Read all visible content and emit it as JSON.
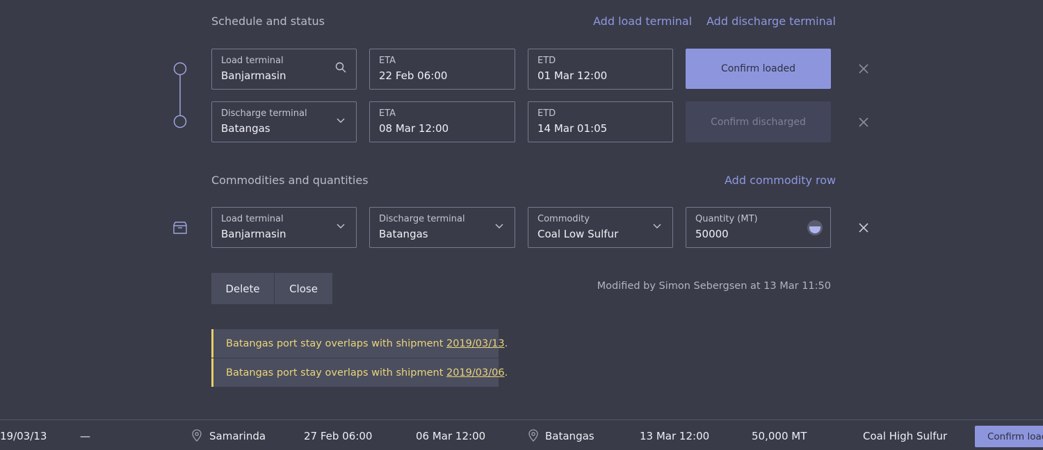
{
  "schedule": {
    "title": "Schedule and status",
    "add_load_link": "Add load terminal",
    "add_discharge_link": "Add discharge terminal",
    "load_row": {
      "terminal_label": "Load terminal",
      "terminal_value": "Banjarmasin",
      "eta_label": "ETA",
      "eta_value": "22 Feb 06:00",
      "etd_label": "ETD",
      "etd_value": "01 Mar 12:00",
      "confirm_label": "Confirm loaded"
    },
    "discharge_row": {
      "terminal_label": "Discharge terminal",
      "terminal_value": "Batangas",
      "eta_label": "ETA",
      "eta_value": "08 Mar 12:00",
      "etd_label": "ETD",
      "etd_value": "14 Mar 01:05",
      "confirm_label": "Confirm discharged"
    }
  },
  "commodities": {
    "title": "Commodities and quantities",
    "add_row_link": "Add commodity row",
    "row": {
      "load_label": "Load terminal",
      "load_value": "Banjarmasin",
      "discharge_label": "Discharge terminal",
      "discharge_value": "Batangas",
      "commodity_label": "Commodity",
      "commodity_value": "Coal Low Sulfur",
      "quantity_label": "Quantity (MT)",
      "quantity_value": "50000"
    }
  },
  "actions": {
    "delete_label": "Delete",
    "close_label": "Close",
    "modified_text": "Modified by Simon Sebergsen at 13 Mar 11:50"
  },
  "warnings": [
    {
      "text": "Batangas port stay overlaps with shipment ",
      "link": "2019/03/13",
      "suffix": "."
    },
    {
      "text": "Batangas port stay overlaps with shipment ",
      "link": "2019/03/06",
      "suffix": "."
    }
  ],
  "bottom_row": {
    "id": "19/03/13",
    "dash": "—",
    "load_port": "Samarinda",
    "eta": "27 Feb 06:00",
    "etd": "06 Mar 12:00",
    "discharge_port": "Batangas",
    "discharge_date": "13 Mar 12:00",
    "quantity": "50,000 MT",
    "commodity": "Coal High Sulfur",
    "confirm_label": "Confirm loaded"
  },
  "colors": {
    "background": "#393b48",
    "accent": "#8d96dd",
    "link": "#8e98e0",
    "warning": "#e6cf6c"
  }
}
